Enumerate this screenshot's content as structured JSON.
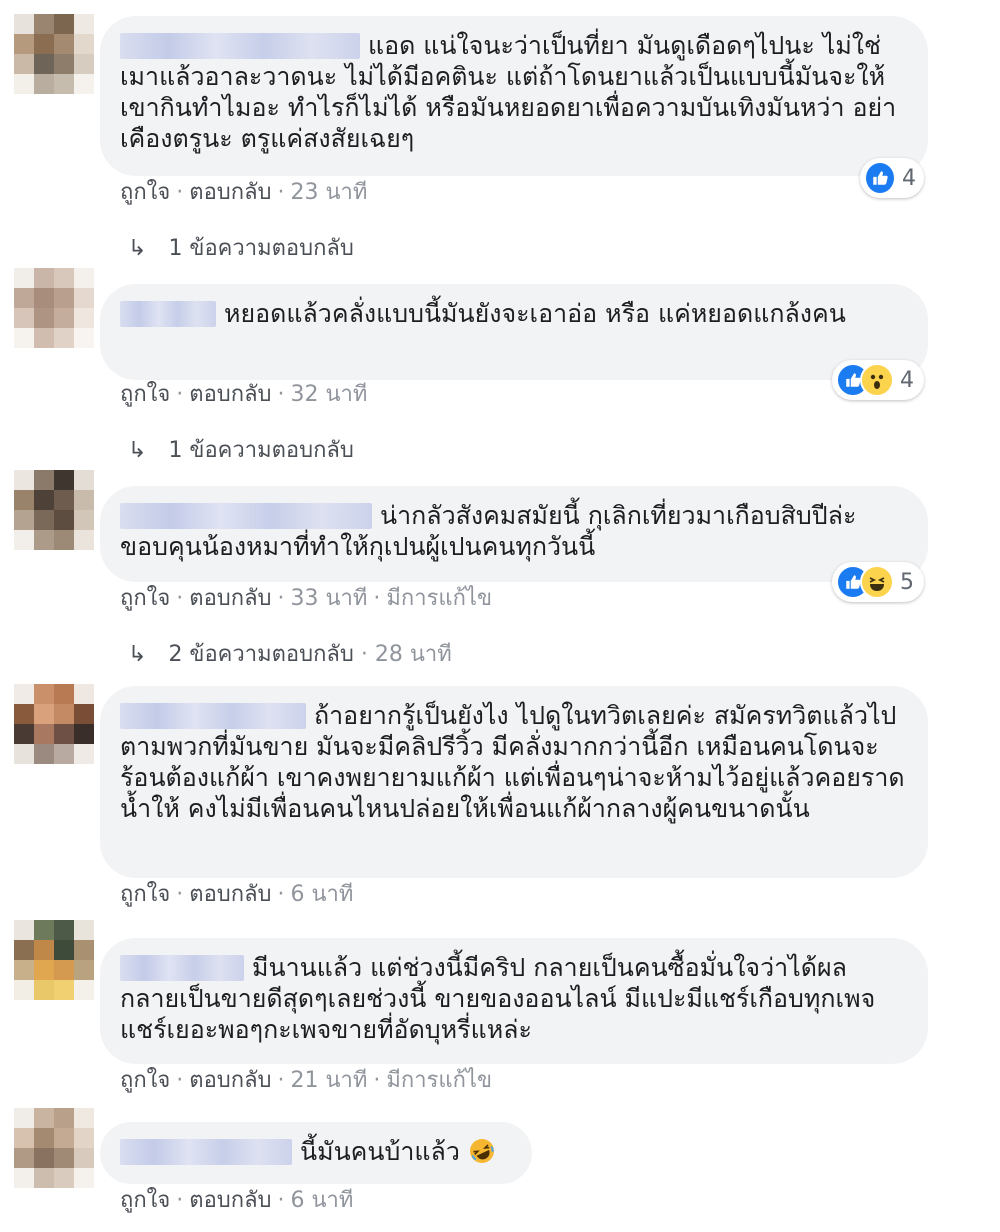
{
  "colors": {
    "bubble_bg": "#f2f3f5",
    "like_blue": "#1a7cf0",
    "meta_grey": "#90949c",
    "text": "#1c1e21"
  },
  "comments": [
    {
      "text": "แอด แน่ใจนะว่าเป็นที่ยา มันดูเดือดๆไปนะ ไม่ใช่เมาแล้วอาละวาดนะ ไม่ได้มีอคตินะ แต่ถ้าโดนยาแล้วเป็นแบบนี้มันจะให้เขากินทำไมอะ ทำไรก็ไม่ได้ หรือมันหยอดยาเพื่อความบันเทิงมันหว่า อย่าเคืองตรูนะ ตรูแค่สงสัยเฉยๆ",
      "like": "ถูกใจ",
      "reply": "ตอบกลับ",
      "time": "23 นาที",
      "reactions": {
        "icons": [
          "like-icon"
        ],
        "count": "4"
      },
      "replies": "1 ข้อความตอบกลับ"
    },
    {
      "text": "หยอดแล้วคลั่งแบบนี้มันยังจะเอาอ่อ หรือ แค่หยอดแกล้งคน",
      "like": "ถูกใจ",
      "reply": "ตอบกลับ",
      "time": "32 นาที",
      "reactions": {
        "icons": [
          "like-icon",
          "wow-icon"
        ],
        "count": "4"
      },
      "replies": "1 ข้อความตอบกลับ"
    },
    {
      "text": "น่ากลัวสังคมสมัยนี้ กุเลิกเที่ยวมาเกือบสิบปีล่ะ ขอบคุนน้องหมาที่ทำให้กุเปนผู้เปนคนทุกวันนี้",
      "like": "ถูกใจ",
      "reply": "ตอบกลับ",
      "time": "33 นาที",
      "edited": "มีการแก้ไข",
      "reactions": {
        "icons": [
          "like-icon",
          "haha-icon"
        ],
        "count": "5"
      },
      "replies": "2 ข้อความตอบกลับ",
      "replies_time": "28 นาที"
    },
    {
      "text": "ถ้าอยากรู้เป็นยังไง ไปดูในทวิตเลยค่ะ สมัครทวิตแล้วไปตามพวกที่มันขาย มันจะมีคลิปรีวิ้ว มีคลั่งมากกว่านี้อีก เหมือนคนโดนจะร้อนต้องแก้ผ้า เขาคงพยายามแก้ผ้า แต่เพื่อนๆน่าจะห้ามไว้อยู่แล้วคอยราดน้ำให้ คงไม่มีเพื่อนคนไหนปล่อยให้เพื่อนแก้ผ้ากลางผู้คนขนาดนั้น",
      "like": "ถูกใจ",
      "reply": "ตอบกลับ",
      "time": "6 นาที"
    },
    {
      "text": "มีนานแล้ว แต่ช่วงนี้มีคริป กลายเป็นคนซื้อมั่นใจว่าได้ผล กลายเป็นขายดีสุดๆเลยช่วงนี้ ขายของออนไลน์ มีแปะมีแชร์เกือบทุกเพจ แชร์เยอะพอๆกะเพจขายที่อัดบุหรี่แหล่ะ",
      "like": "ถูกใจ",
      "reply": "ตอบกลับ",
      "time": "21 นาที",
      "edited": "มีการแก้ไข"
    },
    {
      "text": "นี้มันคนบ้าแล้ว",
      "like": "ถูกใจ",
      "reply": "ตอบกลับ",
      "time": "6 นาที"
    }
  ]
}
